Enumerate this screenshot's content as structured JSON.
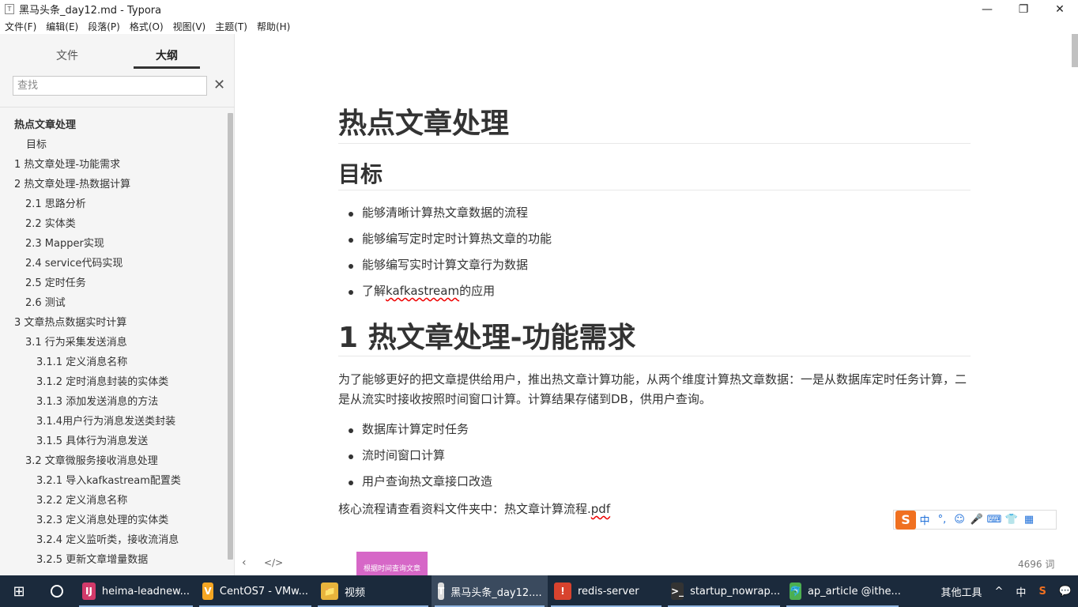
{
  "window": {
    "title": "黑马头条_day12.md - Typora",
    "controls": [
      "—",
      "❐",
      "✕"
    ]
  },
  "menu": [
    "文件(F)",
    "编辑(E)",
    "段落(P)",
    "格式(O)",
    "视图(V)",
    "主题(T)",
    "帮助(H)"
  ],
  "sidebar": {
    "tabs": [
      "文件",
      "大纲"
    ],
    "active_tab": "大纲",
    "search_placeholder": "查找",
    "outline": [
      {
        "label": "热点文章处理",
        "level": "level1 bold"
      },
      {
        "label": "目标",
        "level": "level2"
      },
      {
        "label": "1 热文章处理-功能需求",
        "level": "level1"
      },
      {
        "label": "2 热文章处理-热数据计算",
        "level": "level1"
      },
      {
        "label": "2.1 思路分析",
        "level": "level2b"
      },
      {
        "label": "2.2 实体类",
        "level": "level2b"
      },
      {
        "label": "2.3 Mapper实现",
        "level": "level2b"
      },
      {
        "label": "2.4 service代码实现",
        "level": "level2b"
      },
      {
        "label": "2.5 定时任务",
        "level": "level2b"
      },
      {
        "label": "2.6 测试",
        "level": "level2b"
      },
      {
        "label": "3 文章热点数据实时计算",
        "level": "level1"
      },
      {
        "label": "3.1 行为采集发送消息",
        "level": "level2b"
      },
      {
        "label": "3.1.1 定义消息名称",
        "level": "level3"
      },
      {
        "label": "3.1.2 定时消息封装的实体类",
        "level": "level3"
      },
      {
        "label": "3.1.3 添加发送消息的方法",
        "level": "level3"
      },
      {
        "label": "3.1.4用户行为消息发送类封装",
        "level": "level3"
      },
      {
        "label": "3.1.5 具体行为消息发送",
        "level": "level3"
      },
      {
        "label": "3.2 文章微服务接收消息处理",
        "level": "level2b"
      },
      {
        "label": "3.2.1 导入kafkastream配置类",
        "level": "level3"
      },
      {
        "label": "3.2.2 定义消息名称",
        "level": "level3"
      },
      {
        "label": "3.2.3 定义消息处理的实体类",
        "level": "level3"
      },
      {
        "label": "3.2.4 定义监听类，接收流消息",
        "level": "level3"
      },
      {
        "label": "3.2.5 更新文章增量数据",
        "level": "level3"
      }
    ]
  },
  "document": {
    "h1": "热点文章处理",
    "h2": "目标",
    "goals": [
      "能够清晰计算热文章数据的流程",
      "能够编写定时定时计算热文章的功能",
      "能够编写实时计算文章行为数据",
      "了解kafkastream的应用"
    ],
    "h1b": "1 热文章处理-功能需求",
    "paragraph": "为了能够更好的把文章提供给用户，推出热文章计算功能，从两个维度计算热文章数据：一是从数据库定时任务计算，二是从流实时接收按照时间窗口计算。计算结果存储到DB，供用户查询。",
    "features": [
      "数据库计算定时任务",
      "流时间窗口计算",
      "用户查询热文章接口改造"
    ],
    "para2_prefix": "核心流程请查看资料文件夹中：热文章计算流程.",
    "para2_link": "pdf",
    "image_caption": "根据时间查询文章",
    "word_count": "4696 词"
  },
  "ime": {
    "logo": "S",
    "icons": [
      "中",
      "°,",
      "☺",
      "🎤",
      "⌨",
      "👕",
      "▦"
    ]
  },
  "taskbar": {
    "apps": [
      {
        "label": "heima-leadnew...",
        "icon": "IJ",
        "color": "#d23a6a"
      },
      {
        "label": "CentOS7 - VMw...",
        "icon": "V",
        "color": "#f5a623"
      },
      {
        "label": "视频",
        "icon": "📁",
        "color": "#e8b43c"
      },
      {
        "label": "黑马头条_day12....",
        "icon": "T",
        "color": "#dddddd",
        "active": true
      },
      {
        "label": "redis-server",
        "icon": "!",
        "color": "#d8432e"
      },
      {
        "label": "startup_nowrap...",
        "icon": ">_",
        "color": "#333333"
      },
      {
        "label": "ap_article @ithe...",
        "icon": "🐬",
        "color": "#4caf50"
      }
    ],
    "tray": [
      "其他工具",
      "»",
      "^",
      "中",
      "S",
      "💬"
    ]
  }
}
